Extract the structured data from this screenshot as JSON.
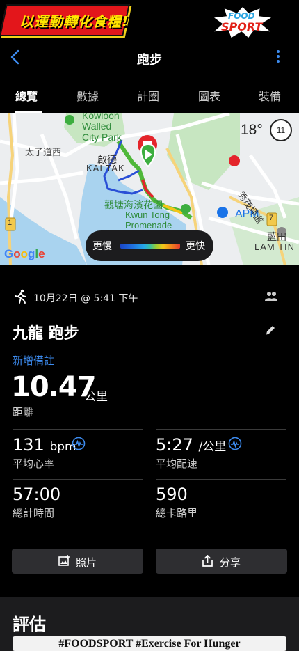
{
  "banner": {
    "left_text": "以運動轉化食糧!",
    "logo_line1": "FOOD",
    "logo_line2": "SPORT"
  },
  "header": {
    "title": "跑步"
  },
  "tabs": [
    {
      "label": "總覽",
      "active": true
    },
    {
      "label": "數據"
    },
    {
      "label": "計圈"
    },
    {
      "label": "圖表"
    },
    {
      "label": "裝備"
    }
  ],
  "map": {
    "labels": {
      "kowloon": "Kowloon",
      "walled": "Walled",
      "city_park": "City Park",
      "kai_tak_cn": "啟德",
      "kai_tak_en": "KAI TAK",
      "taizi": "太子道西",
      "guantang": "觀塘海濱花園",
      "kwun_tong": "Kwun Tong",
      "promenade": "Promenade",
      "apm": "APM",
      "lam_tin_cn": "藍田",
      "lam_tin_en": "LAM TIN",
      "xiumao": "秀茂坪道",
      "road1": "1",
      "road7": "7"
    },
    "weather": {
      "temp": "18°",
      "aqi": "11"
    },
    "legend": {
      "slower": "更慢",
      "faster": "更快"
    },
    "google": [
      "G",
      "o",
      "o",
      "g",
      "l",
      "e"
    ],
    "colors": {
      "water": "#a9d3ef",
      "park": "#c7e6c1",
      "route_blue": "#2a4fd6",
      "route_green": "#4fb83a",
      "start": "#3cae3f",
      "end": "#e4252b"
    }
  },
  "activity": {
    "date": "10月22日 @ 5:41 下午",
    "title": "九龍 跑步",
    "add_note": "新增備註",
    "distance": {
      "value": "10.47",
      "unit": "公里",
      "label": "距離"
    },
    "stats": [
      {
        "value": "131",
        "unit": "bpm",
        "label": "平均心率"
      },
      {
        "value": "5:27",
        "unit": "/公里",
        "label": "平均配速"
      },
      {
        "value": "57:00",
        "unit": "",
        "label": "總計時間"
      },
      {
        "value": "590",
        "unit": "",
        "label": "總卡路里"
      }
    ]
  },
  "buttons": {
    "photos": "照片",
    "share": "分享"
  },
  "assessment": {
    "title": "評估"
  },
  "footer": {
    "hashtag": "#FOODSPORT #Exercise For Hunger"
  }
}
